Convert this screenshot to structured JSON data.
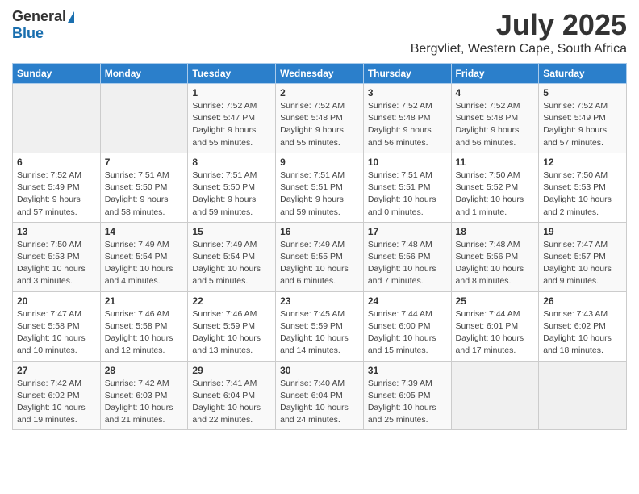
{
  "header": {
    "logo_general": "General",
    "logo_blue": "Blue",
    "title_month": "July 2025",
    "title_location": "Bergvliet, Western Cape, South Africa"
  },
  "calendar": {
    "headers": [
      "Sunday",
      "Monday",
      "Tuesday",
      "Wednesday",
      "Thursday",
      "Friday",
      "Saturday"
    ],
    "weeks": [
      [
        {
          "day": "",
          "detail": ""
        },
        {
          "day": "",
          "detail": ""
        },
        {
          "day": "1",
          "detail": "Sunrise: 7:52 AM\nSunset: 5:47 PM\nDaylight: 9 hours\nand 55 minutes."
        },
        {
          "day": "2",
          "detail": "Sunrise: 7:52 AM\nSunset: 5:48 PM\nDaylight: 9 hours\nand 55 minutes."
        },
        {
          "day": "3",
          "detail": "Sunrise: 7:52 AM\nSunset: 5:48 PM\nDaylight: 9 hours\nand 56 minutes."
        },
        {
          "day": "4",
          "detail": "Sunrise: 7:52 AM\nSunset: 5:48 PM\nDaylight: 9 hours\nand 56 minutes."
        },
        {
          "day": "5",
          "detail": "Sunrise: 7:52 AM\nSunset: 5:49 PM\nDaylight: 9 hours\nand 57 minutes."
        }
      ],
      [
        {
          "day": "6",
          "detail": "Sunrise: 7:52 AM\nSunset: 5:49 PM\nDaylight: 9 hours\nand 57 minutes."
        },
        {
          "day": "7",
          "detail": "Sunrise: 7:51 AM\nSunset: 5:50 PM\nDaylight: 9 hours\nand 58 minutes."
        },
        {
          "day": "8",
          "detail": "Sunrise: 7:51 AM\nSunset: 5:50 PM\nDaylight: 9 hours\nand 59 minutes."
        },
        {
          "day": "9",
          "detail": "Sunrise: 7:51 AM\nSunset: 5:51 PM\nDaylight: 9 hours\nand 59 minutes."
        },
        {
          "day": "10",
          "detail": "Sunrise: 7:51 AM\nSunset: 5:51 PM\nDaylight: 10 hours\nand 0 minutes."
        },
        {
          "day": "11",
          "detail": "Sunrise: 7:50 AM\nSunset: 5:52 PM\nDaylight: 10 hours\nand 1 minute."
        },
        {
          "day": "12",
          "detail": "Sunrise: 7:50 AM\nSunset: 5:53 PM\nDaylight: 10 hours\nand 2 minutes."
        }
      ],
      [
        {
          "day": "13",
          "detail": "Sunrise: 7:50 AM\nSunset: 5:53 PM\nDaylight: 10 hours\nand 3 minutes."
        },
        {
          "day": "14",
          "detail": "Sunrise: 7:49 AM\nSunset: 5:54 PM\nDaylight: 10 hours\nand 4 minutes."
        },
        {
          "day": "15",
          "detail": "Sunrise: 7:49 AM\nSunset: 5:54 PM\nDaylight: 10 hours\nand 5 minutes."
        },
        {
          "day": "16",
          "detail": "Sunrise: 7:49 AM\nSunset: 5:55 PM\nDaylight: 10 hours\nand 6 minutes."
        },
        {
          "day": "17",
          "detail": "Sunrise: 7:48 AM\nSunset: 5:56 PM\nDaylight: 10 hours\nand 7 minutes."
        },
        {
          "day": "18",
          "detail": "Sunrise: 7:48 AM\nSunset: 5:56 PM\nDaylight: 10 hours\nand 8 minutes."
        },
        {
          "day": "19",
          "detail": "Sunrise: 7:47 AM\nSunset: 5:57 PM\nDaylight: 10 hours\nand 9 minutes."
        }
      ],
      [
        {
          "day": "20",
          "detail": "Sunrise: 7:47 AM\nSunset: 5:58 PM\nDaylight: 10 hours\nand 10 minutes."
        },
        {
          "day": "21",
          "detail": "Sunrise: 7:46 AM\nSunset: 5:58 PM\nDaylight: 10 hours\nand 12 minutes."
        },
        {
          "day": "22",
          "detail": "Sunrise: 7:46 AM\nSunset: 5:59 PM\nDaylight: 10 hours\nand 13 minutes."
        },
        {
          "day": "23",
          "detail": "Sunrise: 7:45 AM\nSunset: 5:59 PM\nDaylight: 10 hours\nand 14 minutes."
        },
        {
          "day": "24",
          "detail": "Sunrise: 7:44 AM\nSunset: 6:00 PM\nDaylight: 10 hours\nand 15 minutes."
        },
        {
          "day": "25",
          "detail": "Sunrise: 7:44 AM\nSunset: 6:01 PM\nDaylight: 10 hours\nand 17 minutes."
        },
        {
          "day": "26",
          "detail": "Sunrise: 7:43 AM\nSunset: 6:02 PM\nDaylight: 10 hours\nand 18 minutes."
        }
      ],
      [
        {
          "day": "27",
          "detail": "Sunrise: 7:42 AM\nSunset: 6:02 PM\nDaylight: 10 hours\nand 19 minutes."
        },
        {
          "day": "28",
          "detail": "Sunrise: 7:42 AM\nSunset: 6:03 PM\nDaylight: 10 hours\nand 21 minutes."
        },
        {
          "day": "29",
          "detail": "Sunrise: 7:41 AM\nSunset: 6:04 PM\nDaylight: 10 hours\nand 22 minutes."
        },
        {
          "day": "30",
          "detail": "Sunrise: 7:40 AM\nSunset: 6:04 PM\nDaylight: 10 hours\nand 24 minutes."
        },
        {
          "day": "31",
          "detail": "Sunrise: 7:39 AM\nSunset: 6:05 PM\nDaylight: 10 hours\nand 25 minutes."
        },
        {
          "day": "",
          "detail": ""
        },
        {
          "day": "",
          "detail": ""
        }
      ]
    ]
  }
}
